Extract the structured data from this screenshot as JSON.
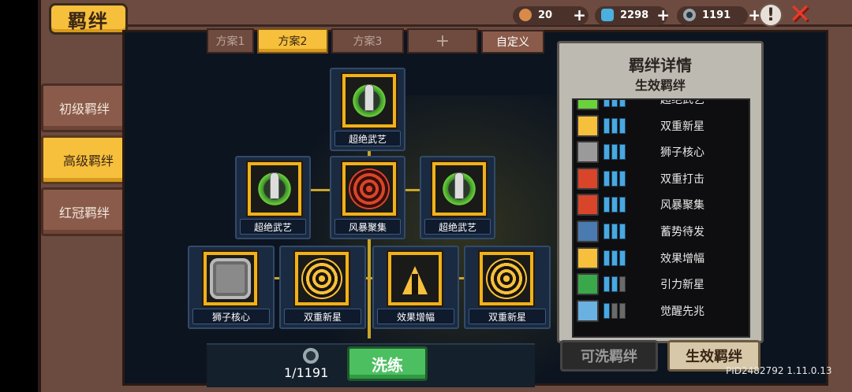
{
  "title": "羁绊",
  "currency": [
    {
      "icon": "hand-icon",
      "value": "20",
      "plus": "+"
    },
    {
      "icon": "gem-icon",
      "value": "2298",
      "plus": "+"
    },
    {
      "icon": "ring-icon",
      "value": "1191",
      "plus": "+"
    }
  ],
  "alert_symbol": "!",
  "close_symbol": "✕",
  "side_tabs": [
    {
      "label": "初级羁绊"
    },
    {
      "label": "高级羁绊"
    },
    {
      "label": "红冠羁绊"
    }
  ],
  "scheme_tabs": [
    {
      "label": "方案1"
    },
    {
      "label": "方案2"
    },
    {
      "label": "方案3"
    },
    {
      "label": "+"
    }
  ],
  "scheme_custom": "自定义",
  "tree": {
    "top": {
      "label": "超绝武艺",
      "icon": "sword-icon"
    },
    "mid": [
      {
        "label": "超绝武艺",
        "icon": "sword-icon"
      },
      {
        "label": "风暴聚集",
        "icon": "red-target-icon"
      },
      {
        "label": "超绝武艺",
        "icon": "sword-icon"
      }
    ],
    "bottom": [
      {
        "label": "狮子核心",
        "icon": "lion-icon"
      },
      {
        "label": "双重新星",
        "icon": "gold-target-icon"
      },
      {
        "label": "效果增幅",
        "icon": "hands-icon"
      },
      {
        "label": "双重新星",
        "icon": "gold-target-icon"
      }
    ]
  },
  "wash": {
    "count": "1/1191",
    "button": "洗练"
  },
  "details": {
    "title": "羁绊详情",
    "subtitle": "生效羁绊",
    "rows": [
      {
        "name": "超绝武艺",
        "on": 3
      },
      {
        "name": "双重新星",
        "on": 3
      },
      {
        "name": "狮子核心",
        "on": 3
      },
      {
        "name": "双重打击",
        "on": 3
      },
      {
        "name": "风暴聚集",
        "on": 3
      },
      {
        "name": "蓄势待发",
        "on": 3
      },
      {
        "name": "效果增幅",
        "on": 3
      },
      {
        "name": "引力新星",
        "on": 2
      },
      {
        "name": "觉醒先兆",
        "on": 1
      }
    ]
  },
  "bottom_tabs": {
    "inactive": "可洗羁绊",
    "active": "生效羁绊"
  },
  "pid": "PID2482792 1.11.0.13",
  "colors": {
    "accent": "#f6c03c",
    "frame": "#6b4a40",
    "panel": "#0c1420",
    "bar_on": "#4aa8e0",
    "wash_green": "#4cc060"
  }
}
